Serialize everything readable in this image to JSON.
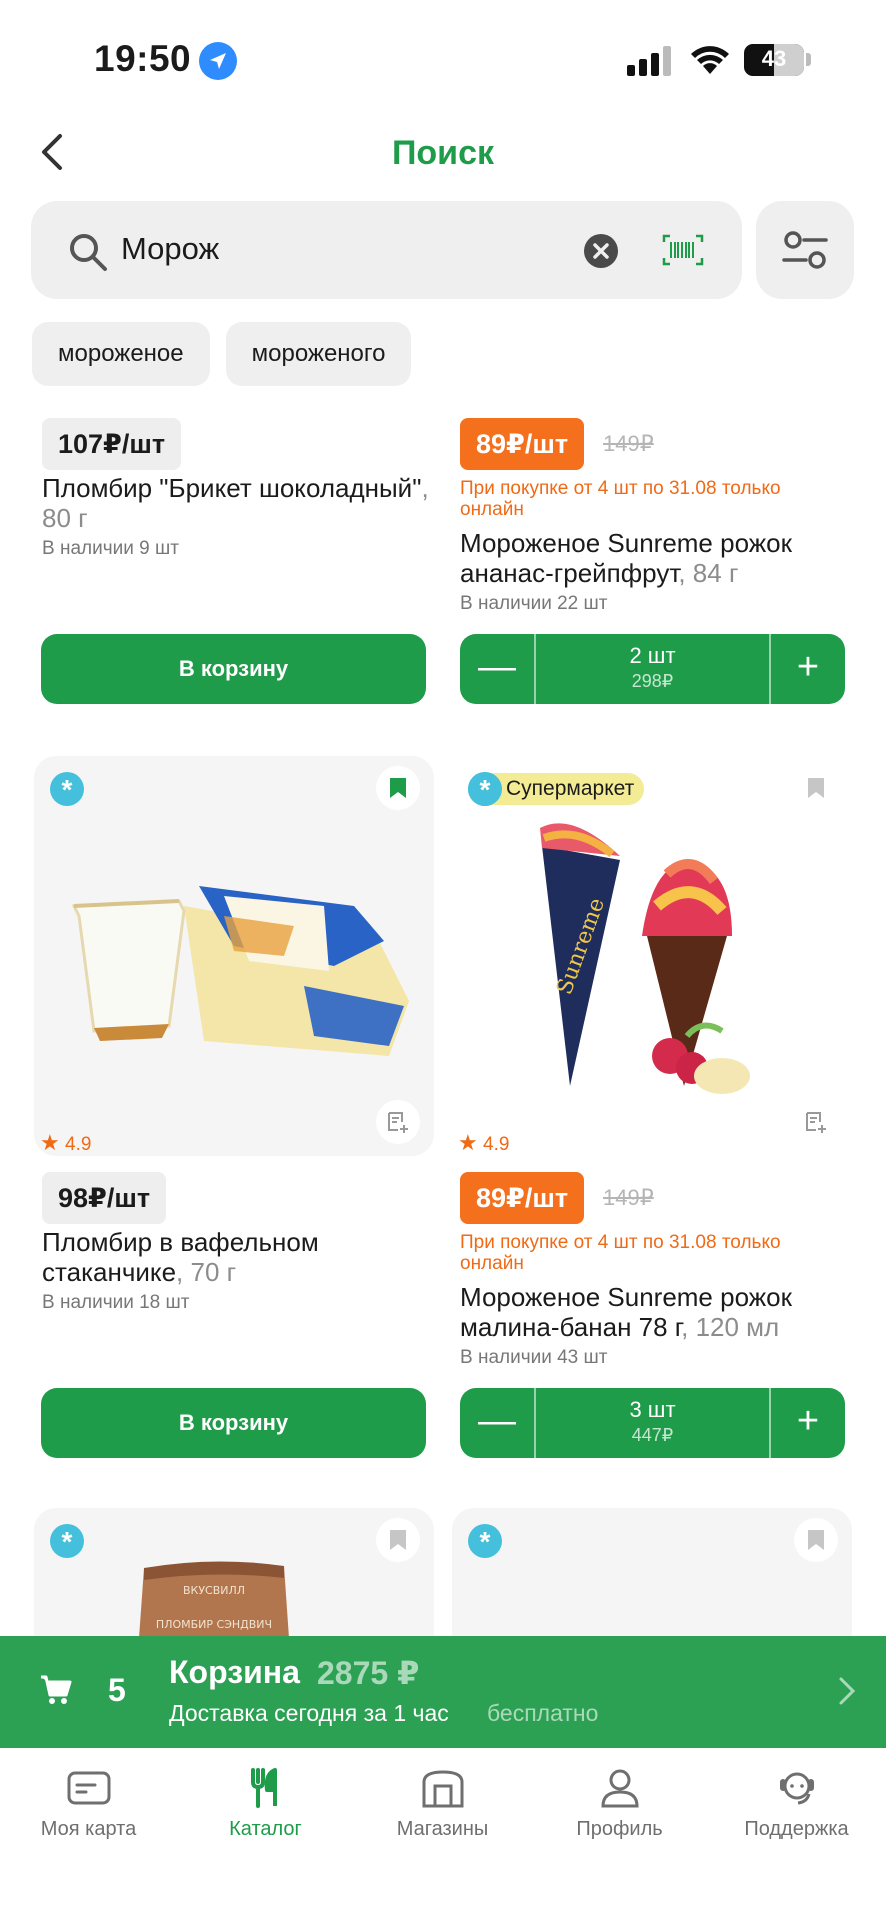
{
  "status_bar": {
    "time": "19:50",
    "battery": "43"
  },
  "header": {
    "title": "Поиск"
  },
  "search": {
    "query": "Морож"
  },
  "suggestions": [
    "мороженое",
    "мороженого"
  ],
  "products": [
    {
      "price": "107₽/шт",
      "name": "Пломбир \"Брикет шоколадный\"",
      "weight": ", 80 г",
      "stock": "В наличии 9 шт",
      "button": "В корзину"
    },
    {
      "price": "89₽/шт",
      "old_price": "149₽",
      "promo": "При покупке от 4 шт по 31.08 только онлайн",
      "name": "Мороженое Sunreme рожок ананас-грейпфрут",
      "weight": ", 84 г",
      "stock": "В наличии 22 шт",
      "qty": "2 шт",
      "sum": "298₽"
    },
    {
      "rating": "4.9",
      "price": "98₽/шт",
      "name": "Пломбир в вафельном стаканчике",
      "weight": ", 70 г",
      "stock": "В наличии 18 шт",
      "button": "В корзину"
    },
    {
      "badge": "Супермаркет",
      "rating": "4.9",
      "price": "89₽/шт",
      "old_price": "149₽",
      "promo": "При покупке от 4 шт по 31.08 только онлайн",
      "name": "Мороженое Sunreme рожок малина-банан 78 г",
      "weight": ", 120 мл",
      "stock": "В наличии 43 шт",
      "qty": "3 шт",
      "sum": "447₽"
    }
  ],
  "package_text": {
    "brand": "ВКУСВИЛЛ",
    "product": "ПЛОМБИР СЭНДВИЧ"
  },
  "cart_bar": {
    "count": "5",
    "label": "Корзина",
    "total": "2875 ₽",
    "delivery": "Доставка сегодня за 1 час",
    "delivery_price": "бесплатно"
  },
  "nav": {
    "items": [
      "Моя карта",
      "Каталог",
      "Магазины",
      "Профиль",
      "Поддержка"
    ],
    "active": "Каталог"
  },
  "colors": {
    "accent": "#1f9c4a",
    "promo": "#f4701d",
    "cart_bar": "#2ca154"
  }
}
